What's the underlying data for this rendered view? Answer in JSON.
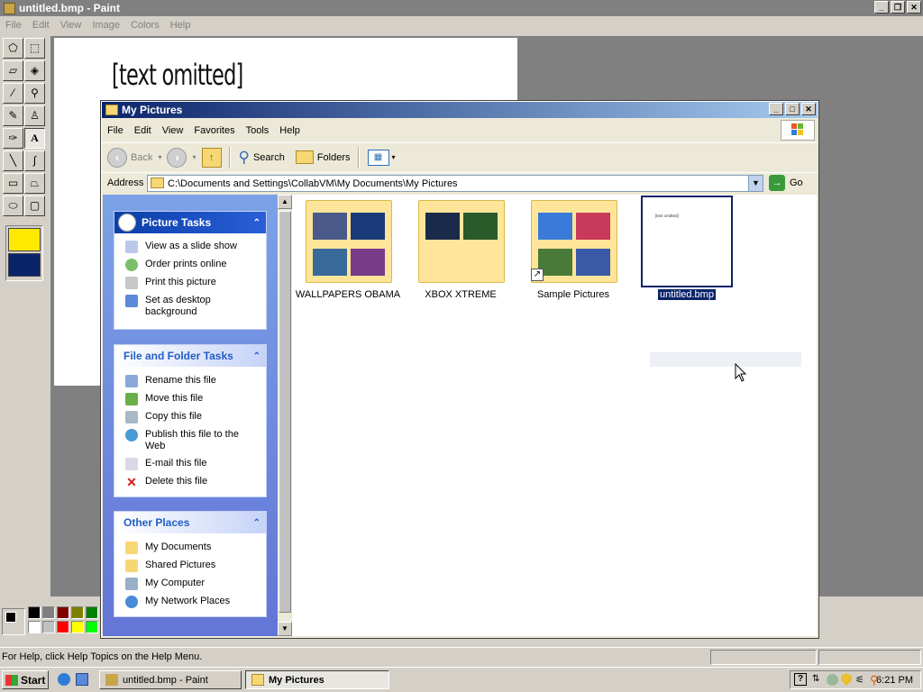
{
  "paint": {
    "title": "untitled.bmp - Paint",
    "menu": [
      "File",
      "Edit",
      "View",
      "Image",
      "Colors",
      "Help"
    ],
    "canvas_text": "[text omitted]",
    "status": "For Help, click Help Topics on the Help Menu."
  },
  "explorer": {
    "title": "My Pictures",
    "menu": [
      "File",
      "Edit",
      "View",
      "Favorites",
      "Tools",
      "Help"
    ],
    "toolbar": {
      "back": "Back",
      "search": "Search",
      "folders": "Folders"
    },
    "address_label": "Address",
    "address_value": "C:\\Documents and Settings\\CollabVM\\My Documents\\My Pictures",
    "go_label": "Go",
    "picture_tasks": {
      "title": "Picture Tasks",
      "items": [
        "View as a slide show",
        "Order prints online",
        "Print this picture",
        "Set as desktop background"
      ]
    },
    "file_tasks": {
      "title": "File and Folder Tasks",
      "items": [
        "Rename this file",
        "Move this file",
        "Copy this file",
        "Publish this file to the Web",
        "E-mail this file",
        "Delete this file"
      ]
    },
    "other_places": {
      "title": "Other Places",
      "items": [
        "My Documents",
        "Shared Pictures",
        "My Computer",
        "My Network Places"
      ]
    },
    "files": [
      {
        "label": "WALLPAPERS OBAMA"
      },
      {
        "label": "XBOX XTREME"
      },
      {
        "label": "Sample Pictures"
      },
      {
        "label": "untitled.bmp",
        "selected": true
      }
    ],
    "bmp_preview_text": "[text omitted]"
  },
  "taskbar": {
    "start": "Start",
    "tasks": [
      {
        "label": "untitled.bmp - Paint",
        "active": false
      },
      {
        "label": "My Pictures",
        "active": true
      }
    ],
    "clock": "6:21 PM"
  },
  "colors": {
    "title_active": "#0a246a",
    "selection": "#0a246a",
    "folder": "#ffe59a"
  }
}
